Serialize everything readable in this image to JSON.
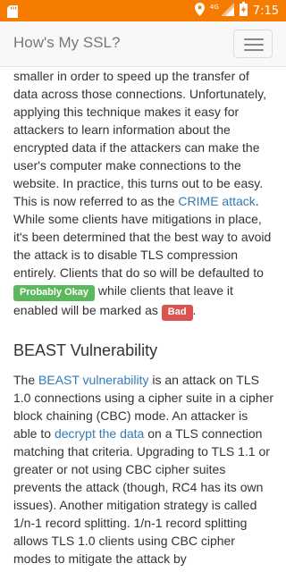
{
  "status_bar": {
    "time": "7:15",
    "network": "4G",
    "sd_icon": "sd-card-icon",
    "location_icon": "location-pin-icon",
    "signal_icon": "cell-signal-icon",
    "battery_icon": "battery-charging-icon",
    "color": "#f57c00"
  },
  "navbar": {
    "brand": "How's My SSL?",
    "menu_icon": "hamburger-menu-icon"
  },
  "compression": {
    "p1": "to make the data in the encrypted connection smaller in order to speed up the transfer of data across those connections. Unfortunately, applying this technique makes it easy for attackers to learn information about the encrypted data if the attackers can make the user's computer make connections to the website. In practice, this turns out to be easy. This is now referred to as the ",
    "crime_link": "CRIME attack",
    "p2": ". While some clients have mitigations in place, it's been determined that the best way to avoid the attack is to disable TLS compression entirely. Clients that do so will be defaulted to ",
    "ok_label": "Probably Okay",
    "p3": " while clients that leave it enabled will be marked as ",
    "bad_label": "Bad",
    "p4": "."
  },
  "beast": {
    "heading": "BEAST Vulnerability",
    "t1": "The ",
    "beast_link": "BEAST vulnerability",
    "t2": " is an attack on TLS 1.0 connections using a cipher suite in a cipher block chaining (CBC) mode. An attacker is able to ",
    "decrypt_link": "decrypt the data",
    "t3": " on a TLS connection matching that criteria. Upgrading to TLS 1.1 or greater or not using CBC cipher suites prevents the attack (though, RC4 has its own issues). Another mitigation strategy is called 1/n-1 record splitting. 1/n-1 record splitting allows TLS 1.0 clients using CBC cipher modes to mitigate the attack by"
  },
  "colors": {
    "link": "#337ab7",
    "probably_okay": "#5cb85c",
    "bad": "#d9534f"
  }
}
